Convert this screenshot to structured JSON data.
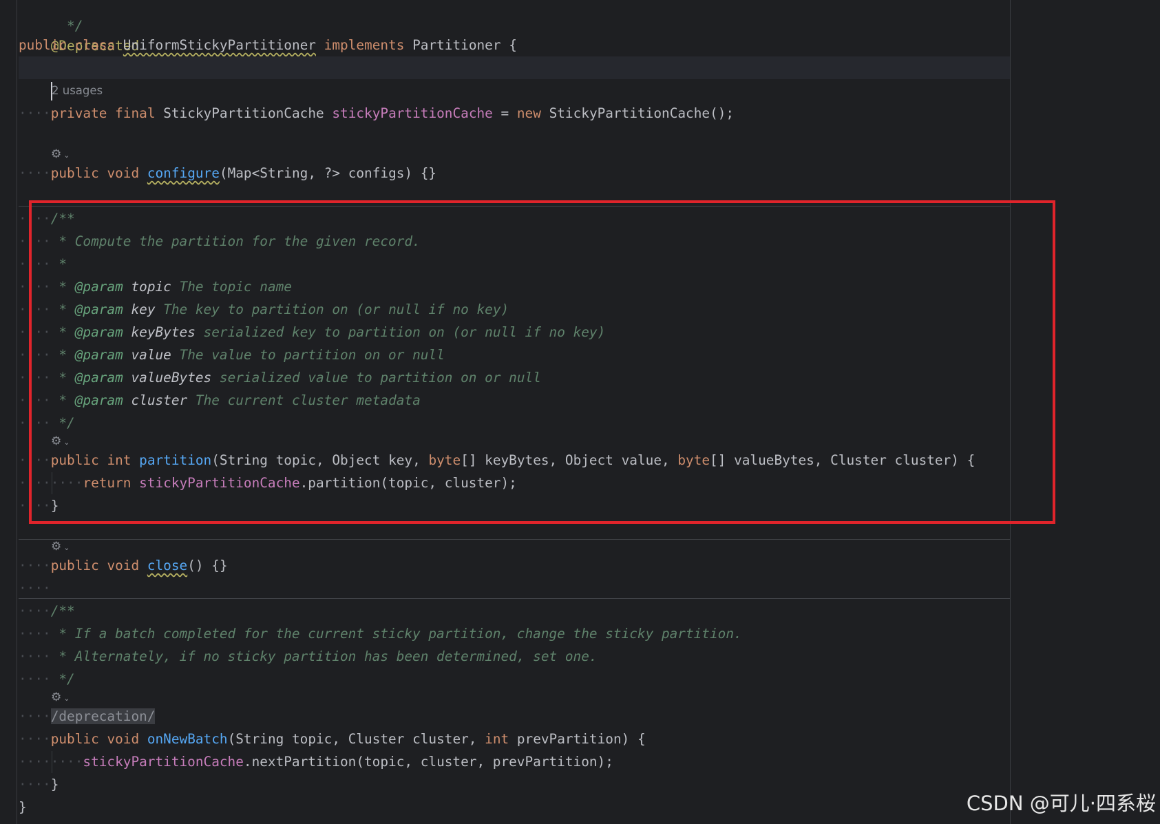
{
  "code": {
    "l0": "  */",
    "annotation": "@Deprecated",
    "class_kw1": "public",
    "class_kw2": "class",
    "class_name": "UniformStickyPartitioner",
    "implements_kw": "implements",
    "iface": "Partitioner",
    "open_brace": " {",
    "usages_hint": "2 usages",
    "field_kw1": "private",
    "field_kw2": "final",
    "field_type": "StickyPartitionCache",
    "field_name": "stickyPartitionCache",
    "field_eq": " = ",
    "field_new": "new",
    "field_ctor": " StickyPartitionCache();",
    "cfg_kw1": "public",
    "cfg_kw2": "void",
    "cfg_name": "configure",
    "cfg_rest": "(Map<String, ?> configs) {}",
    "doc_open": "/**",
    "doc_line1": " * Compute the partition for the given record.",
    "doc_star": " *",
    "p1_tag": "@param",
    "p1_name": "topic",
    "p1_desc": "The topic name",
    "p2_tag": "@param",
    "p2_name": "key",
    "p2_desc": "The key to partition on (or null if no key)",
    "p3_tag": "@param",
    "p3_name": "keyBytes",
    "p3_desc": "serialized key to partition on (or null if no key)",
    "p4_tag": "@param",
    "p4_name": "value",
    "p4_desc": "The value to partition on or null",
    "p5_tag": "@param",
    "p5_name": "valueBytes",
    "p5_desc": "serialized value to partition on or null",
    "p6_tag": "@param",
    "p6_name": "cluster",
    "p6_desc": "The current cluster metadata",
    "doc_close": " */",
    "part_kw1": "public",
    "part_kw2": "int",
    "part_name": "partition",
    "part_a": "(String topic, Object key, ",
    "part_byte1": "byte",
    "part_b": "[] keyBytes, Object value, ",
    "part_byte2": "byte",
    "part_c": "[] valueBytes, Cluster cluster) {",
    "ret_kw": "return",
    "ret_field": "stickyPartitionCache",
    "ret_rest": ".partition(topic, cluster);",
    "close_brace": "}",
    "close_kw1": "public",
    "close_kw2": "void",
    "close_name": "close",
    "close_rest": "() {}",
    "doc2_open": "/**",
    "doc2_l1": " * If a batch completed for the current sticky partition, change the sticky partition.",
    "doc2_l2": " * Alternately, if no sticky partition has been determined, set one.",
    "doc2_close": " */",
    "deprecation_tag": "/deprecation/",
    "nb_kw1": "public",
    "nb_kw2": "void",
    "nb_name": "onNewBatch",
    "nb_a": "(String topic, Cluster cluster, ",
    "nb_int": "int",
    "nb_b": " prevPartition) {",
    "nb_field": "stickyPartitionCache",
    "nb_rest": ".nextPartition(topic, cluster, prevPartition);",
    "nb_close": "}",
    "class_close": "}"
  },
  "icons": {
    "gear": "⚙",
    "chevron": "⌄"
  },
  "watermark": "CSDN @可儿·四系桜",
  "colors": {
    "background": "#1e1f22",
    "keyword": "#cf8e6d",
    "annotation": "#b3ae60",
    "function": "#56a8f5",
    "field": "#c77dbb",
    "comment": "#5f826b",
    "highlight_box": "#e0242b"
  }
}
